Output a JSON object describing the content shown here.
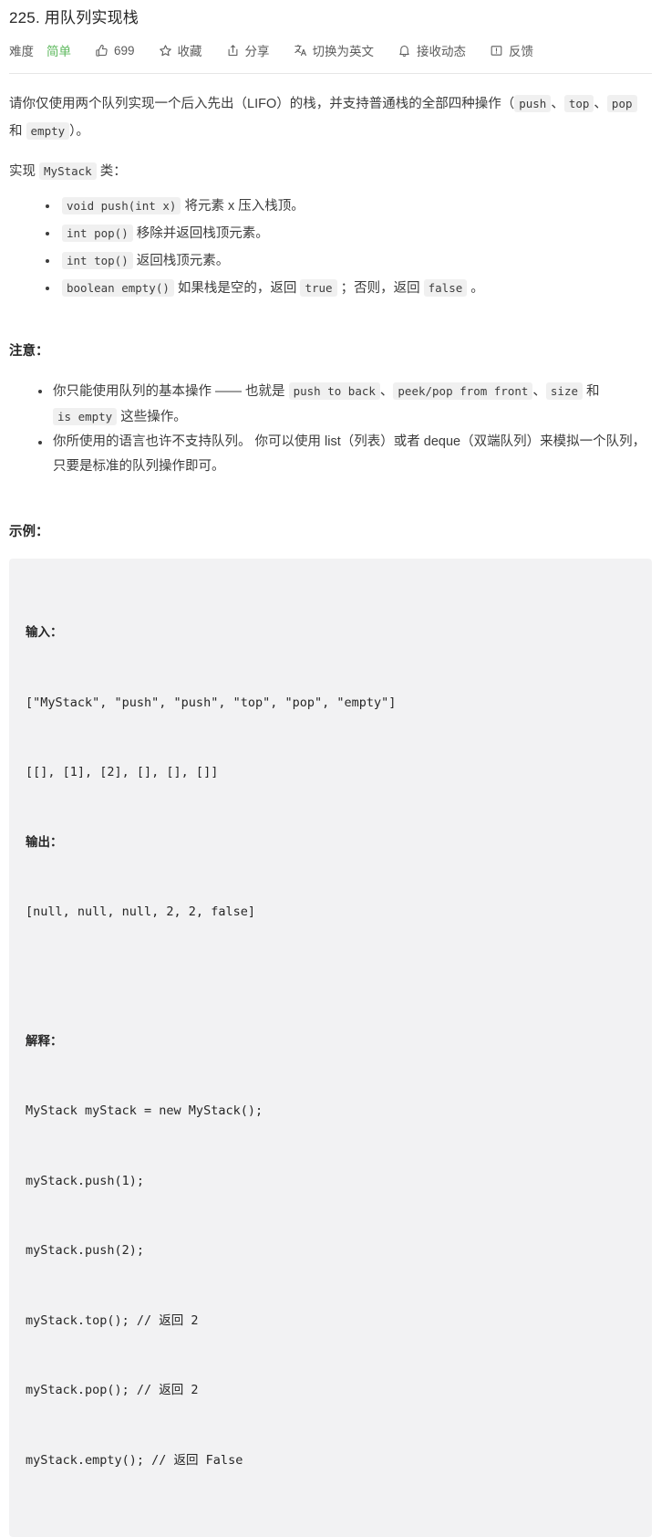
{
  "header": {
    "title": "225. 用队列实现栈",
    "difficulty_label": "难度",
    "difficulty_value": "简单",
    "difficulty_color": "#5cb85c",
    "actions": [
      {
        "icon": "thumbs-up-icon",
        "label": "699"
      },
      {
        "icon": "star-icon",
        "label": "收藏"
      },
      {
        "icon": "share-icon",
        "label": "分享"
      },
      {
        "icon": "translate-icon",
        "label": "切换为英文"
      },
      {
        "icon": "bell-icon",
        "label": "接收动态"
      },
      {
        "icon": "feedback-icon",
        "label": "反馈"
      }
    ]
  },
  "description": {
    "p1_a": "请你仅使用两个队列实现一个后入先出（LIFO）的栈，并支持普通栈的全部四种操作（",
    "p1_code1": "push",
    "p1_b": "、",
    "p1_code2": "top",
    "p1_c": "、",
    "p1_code3": "pop",
    "p1_d": " 和 ",
    "p1_code4": "empty",
    "p1_e": "）。",
    "p2_a": "实现 ",
    "p2_code": "MyStack",
    "p2_b": " 类：",
    "methods": [
      {
        "code": "void push(int x)",
        "text": " 将元素 x 压入栈顶。"
      },
      {
        "code": "int pop()",
        "text": " 移除并返回栈顶元素。"
      },
      {
        "code": "int top()",
        "text": " 返回栈顶元素。"
      },
      {
        "code": "boolean empty()",
        "text_a": " 如果栈是空的，返回 ",
        "code2": "true",
        "text_b": " ；否则，返回 ",
        "code3": "false",
        "text_c": " 。"
      }
    ]
  },
  "note": {
    "heading": "注意：",
    "item1_a": "你只能使用队列的基本操作 —— 也就是 ",
    "item1_code1": "push to back",
    "item1_b": "、",
    "item1_code2": "peek/pop from front",
    "item1_c": "、",
    "item1_code3": "size",
    "item1_d": " 和 ",
    "item1_code4": "is empty",
    "item1_e": " 这些操作。",
    "item2": "你所使用的语言也许不支持队列。 你可以使用 list（列表）或者 deque（双端队列）来模拟一个队列，只要是标准的队列操作即可。"
  },
  "example": {
    "heading": "示例：",
    "input_label": "输入：",
    "input_line1": "[\"MyStack\", \"push\", \"push\", \"top\", \"pop\", \"empty\"]",
    "input_line2": "[[], [1], [2], [], [], []]",
    "output_label": "输出：",
    "output_line": "[null, null, null, 2, 2, false]",
    "explain_label": "解释：",
    "explain_lines": [
      "MyStack myStack = new MyStack();",
      "myStack.push(1);",
      "myStack.push(2);",
      "myStack.top(); // 返回 2",
      "myStack.pop(); // 返回 2",
      "myStack.empty(); // 返回 False"
    ]
  }
}
